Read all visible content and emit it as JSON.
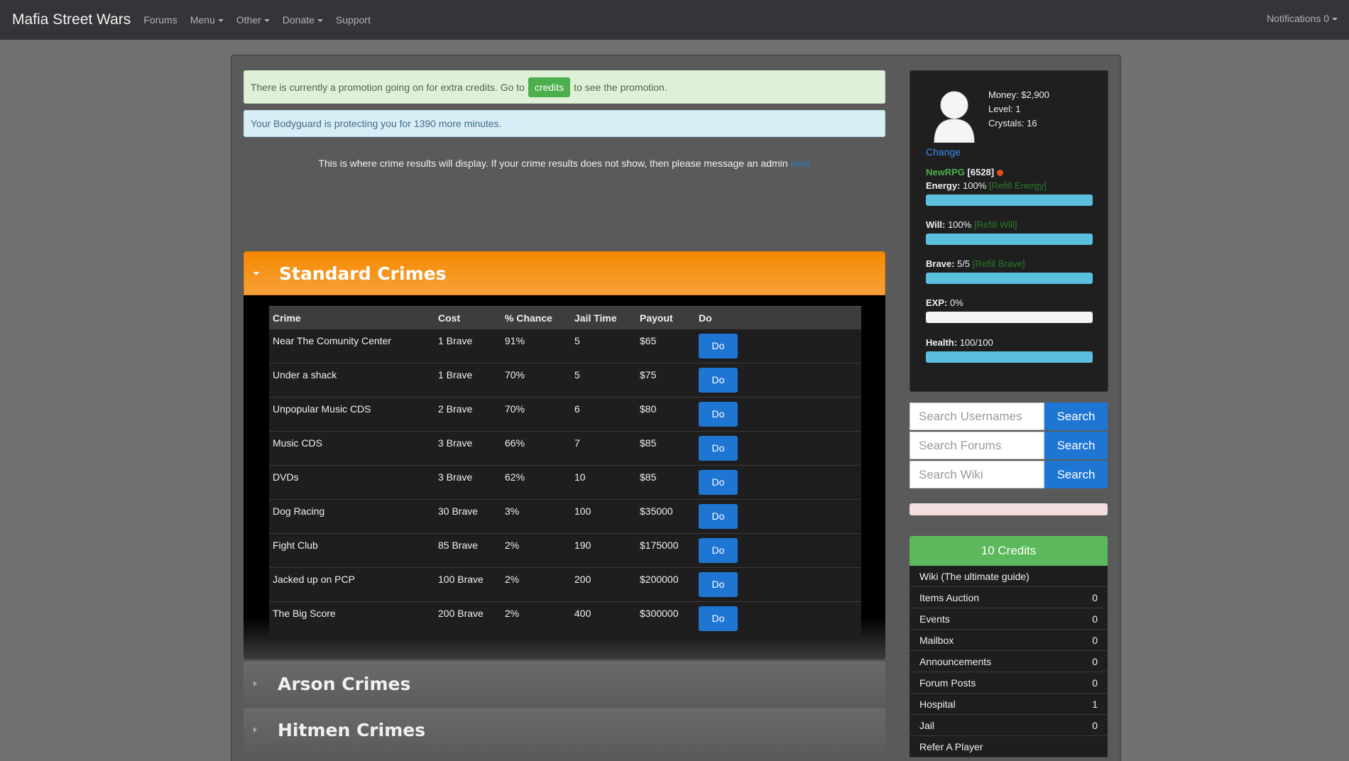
{
  "nav": {
    "brand": "Mafia Street Wars",
    "items": [
      {
        "label": "Forums",
        "dropdown": false
      },
      {
        "label": "Menu",
        "dropdown": true
      },
      {
        "label": "Other",
        "dropdown": true
      },
      {
        "label": "Donate",
        "dropdown": true
      },
      {
        "label": "Support",
        "dropdown": false
      }
    ],
    "notifications": "Notifications 0"
  },
  "alerts": {
    "promo_before": "There is currently a promotion going on for extra credits. Go to",
    "promo_button": "credits",
    "promo_after": "to see the promotion.",
    "bodyguard": "Your Bodyguard is protecting you for 1390 more minutes."
  },
  "crime_note": {
    "text": "This is where crime results will display. If your crime results does not show, then please message an admin",
    "link": "here"
  },
  "sections": {
    "standard": "Standard Crimes",
    "arson": "Arson Crimes",
    "hitmen": "Hitmen Crimes"
  },
  "crimes_table": {
    "headers": [
      "Crime",
      "Cost",
      "% Chance",
      "Jail Time",
      "Payout",
      "Do"
    ],
    "do_label": "Do",
    "rows": [
      {
        "crime": "Near The Comunity Center",
        "cost": "1 Brave",
        "chance": "91%",
        "jail": "5",
        "payout": "$65"
      },
      {
        "crime": "Under a shack",
        "cost": "1 Brave",
        "chance": "70%",
        "jail": "5",
        "payout": "$75"
      },
      {
        "crime": "Unpopular Music CDS",
        "cost": "2 Brave",
        "chance": "70%",
        "jail": "6",
        "payout": "$80"
      },
      {
        "crime": "Music CDS",
        "cost": "3 Brave",
        "chance": "66%",
        "jail": "7",
        "payout": "$85"
      },
      {
        "crime": "DVDs",
        "cost": "3 Brave",
        "chance": "62%",
        "jail": "10",
        "payout": "$85"
      },
      {
        "crime": "Dog Racing",
        "cost": "30 Brave",
        "chance": "3%",
        "jail": "100",
        "payout": "$35000"
      },
      {
        "crime": "Fight Club",
        "cost": "85 Brave",
        "chance": "2%",
        "jail": "190",
        "payout": "$175000"
      },
      {
        "crime": "Jacked up on PCP",
        "cost": "100 Brave",
        "chance": "2%",
        "jail": "200",
        "payout": "$200000"
      },
      {
        "crime": "The Big Score",
        "cost": "200 Brave",
        "chance": "2%",
        "jail": "400",
        "payout": "$300000"
      }
    ]
  },
  "profile": {
    "money": "Money: $2,900",
    "level": "Level: 1",
    "crystals": "Crystals: 16",
    "change": "Change",
    "username": "NewRPG",
    "user_id": "[6528]",
    "energy_label": "Energy:",
    "energy_value": "100%",
    "energy_refill": "[Refill Energy]",
    "energy_pct": 100,
    "will_label": "Will:",
    "will_value": "100%",
    "will_refill": "[Refill Will]",
    "will_pct": 100,
    "brave_label": "Brave:",
    "brave_value": "5/5",
    "brave_refill": "[Refill Brave]",
    "brave_pct": 100,
    "exp_label": "EXP:",
    "exp_value": "0%",
    "exp_pct": 0,
    "health_label": "Health:",
    "health_value": "100/100",
    "health_pct": 100,
    "bar_color": "#5bc0de"
  },
  "search": {
    "usernames_placeholder": "Search Usernames",
    "forums_placeholder": "Search Forums",
    "wiki_placeholder": "Search Wiki",
    "button": "Search"
  },
  "credits": {
    "header": "10 Credits",
    "items": [
      {
        "label": "Wiki (The ultimate guide)",
        "count": ""
      },
      {
        "label": "Items Auction",
        "count": "0"
      },
      {
        "label": "Events",
        "count": "0"
      },
      {
        "label": "Mailbox",
        "count": "0"
      },
      {
        "label": "Announcements",
        "count": "0"
      },
      {
        "label": "Forum Posts",
        "count": "0"
      },
      {
        "label": "Hospital",
        "count": "1"
      },
      {
        "label": "Jail",
        "count": "0"
      },
      {
        "label": "Refer A Player",
        "count": ""
      }
    ]
  }
}
